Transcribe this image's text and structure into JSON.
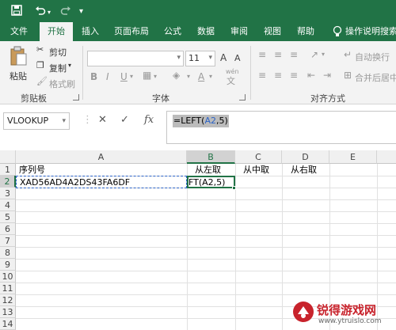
{
  "quick_access": {
    "save_icon": "save-icon",
    "undo_icon": "undo-icon",
    "redo_icon": "redo-icon",
    "customize_icon": "chevron-down-icon"
  },
  "tabs": [
    {
      "label": "文件"
    },
    {
      "label": "开始"
    },
    {
      "label": "插入"
    },
    {
      "label": "页面布局"
    },
    {
      "label": "公式"
    },
    {
      "label": "数据"
    },
    {
      "label": "审阅"
    },
    {
      "label": "视图"
    },
    {
      "label": "帮助"
    }
  ],
  "tell_me": "操作说明搜索",
  "ribbon": {
    "paste_label": "粘贴",
    "cut_label": "剪切",
    "copy_label": "复制",
    "format_painter_label": "格式刷",
    "clipboard_group": "剪贴板",
    "font_size": "11",
    "grow_font": "A",
    "shrink_font": "A",
    "bold": "B",
    "italic": "I",
    "underline": "U",
    "font_group": "字体",
    "wen": "wén",
    "wrap_text": "自动换行",
    "merge_center": "合并后居中",
    "alignment_group": "对齐方式"
  },
  "formula_bar": {
    "name_box": "VLOOKUP",
    "cancel_glyph": "✕",
    "enter_glyph": "✓",
    "fx_glyph": "fx",
    "formula_prefix": "=LEFT(",
    "formula_ref": "A2",
    "formula_suffix": ",5)"
  },
  "grid": {
    "columns": [
      "A",
      "B",
      "C",
      "D",
      "E"
    ],
    "rows": [
      "1",
      "2",
      "3",
      "4",
      "5",
      "6",
      "7",
      "8",
      "9",
      "10",
      "11",
      "12",
      "13",
      "14"
    ],
    "cells": {
      "A1": "序列号",
      "B1": "从左取",
      "C1": "从中取",
      "D1": "从右取",
      "A2": "XAD56AD4A2DS43FA6DF",
      "B2": "FT(A2,5)"
    }
  },
  "watermark": {
    "text": "锐得游戏网",
    "url": "www.ytruislo.com"
  },
  "colors": {
    "accent": "#217346",
    "ribbon_bg": "#f3f3f3",
    "reference_blue": "#2b63c7"
  }
}
